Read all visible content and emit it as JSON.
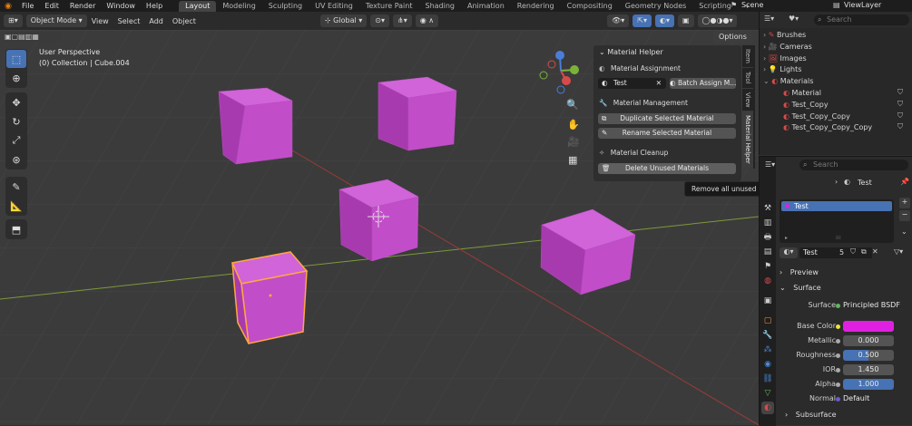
{
  "topbar": {
    "menus": [
      "File",
      "Edit",
      "Render",
      "Window",
      "Help"
    ],
    "workspaces": [
      "Layout",
      "Modeling",
      "Sculpting",
      "UV Editing",
      "Texture Paint",
      "Shading",
      "Animation",
      "Rendering",
      "Compositing",
      "Geometry Nodes",
      "Scripting"
    ],
    "active_workspace": "Layout",
    "add_tab": "+",
    "scene": "Scene",
    "view_layer": "ViewLayer"
  },
  "viewport_header": {
    "mode": "Object Mode",
    "menus": [
      "View",
      "Select",
      "Add",
      "Object"
    ],
    "transform_orientation": "Global",
    "options_label": "Options"
  },
  "viewport": {
    "perspective": "User Perspective",
    "collection_info": "(0) Collection | Cube.004",
    "object_color": "#cc44cc",
    "selected_outline": "#ffa640"
  },
  "material_helper": {
    "title": "Material Helper",
    "assignment_label": "Material Assignment",
    "material_field": "Test",
    "batch_assign": "Batch Assign M...",
    "management_label": "Material Management",
    "duplicate_button": "Duplicate Selected Material",
    "rename_button": "Rename Selected Material",
    "cleanup_label": "Material Cleanup",
    "delete_button": "Delete Unused Materials",
    "tooltip": "Remove all unused materials from the scene."
  },
  "sidebar_tabs": [
    "Item",
    "Tool",
    "View",
    "Material Helper"
  ],
  "outliner": {
    "search_placeholder": "Search",
    "items": [
      {
        "label": "Brushes",
        "depth": 0,
        "icon": "brush-icon"
      },
      {
        "label": "Cameras",
        "depth": 0,
        "icon": "camera-icon"
      },
      {
        "label": "Images",
        "depth": 0,
        "icon": "image-icon"
      },
      {
        "label": "Lights",
        "depth": 0,
        "icon": "light-icon"
      },
      {
        "label": "Materials",
        "depth": 0,
        "icon": "material-icon"
      },
      {
        "label": "Material",
        "depth": 1,
        "icon": "material-icon"
      },
      {
        "label": "Test_Copy",
        "depth": 1,
        "icon": "material-icon"
      },
      {
        "label": "Test_Copy_Copy",
        "depth": 1,
        "icon": "material-icon"
      },
      {
        "label": "Test_Copy_Copy_Copy",
        "depth": 1,
        "icon": "material-icon"
      }
    ]
  },
  "properties": {
    "search_placeholder": "Search",
    "breadcrumb": "Test",
    "slot": "Test",
    "material_name": "Test",
    "user_count": "5",
    "preview_label": "Preview",
    "surface_label": "Surface",
    "surface_shader_label": "Surface",
    "surface_shader": "Principled BSDF",
    "base_color_label": "Base Color",
    "base_color": "#e020e0",
    "metallic_label": "Metallic",
    "metallic": "0.000",
    "roughness_label": "Roughness",
    "roughness": "0.500",
    "ior_label": "IOR",
    "ior": "1.450",
    "alpha_label": "Alpha",
    "alpha": "1.000",
    "normal_label": "Normal",
    "normal": "Default",
    "subsurface_label": "Subsurface"
  },
  "colors": {
    "accent": "#4772b3",
    "active_tab": "#444444"
  }
}
